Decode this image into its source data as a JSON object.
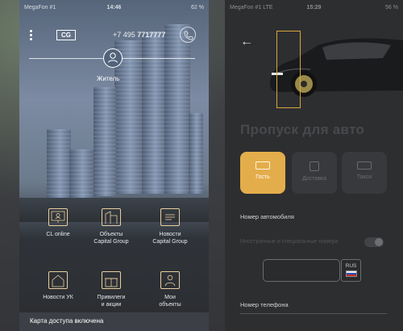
{
  "left_screen": {
    "statusbar": {
      "carrier": "MegaFon #1",
      "time": "14:46",
      "battery": "62 %"
    },
    "header": {
      "logo": "CG",
      "phone_prefix": "+7 495 ",
      "phone_main": "7717777"
    },
    "slider": {
      "label": "Житель"
    },
    "grid": [
      {
        "label": "CL online",
        "icon": "monitor-icon"
      },
      {
        "label": "Объекты\nCapital Group",
        "icon": "building-icon"
      },
      {
        "label": "Новости\nCapital Group",
        "icon": "news-icon"
      },
      {
        "label": "Новости УК",
        "icon": "house-icon"
      },
      {
        "label": "Привилеги\nи акции",
        "icon": "gift-icon"
      },
      {
        "label": "Мои\nобъекты",
        "icon": "user-home-icon"
      }
    ],
    "bottom_bar": {
      "text": "Карта доступа включена"
    }
  },
  "right_screen": {
    "statusbar": {
      "carrier": "MegaFon #1 LTE",
      "time": "15:29",
      "battery": "56 %"
    },
    "title": "Пропуск для авто",
    "types": [
      {
        "label": "Гость",
        "active": true,
        "icon": "car-icon"
      },
      {
        "label": "Доставка",
        "active": false,
        "icon": "delivery-icon"
      },
      {
        "label": "Такси",
        "active": false,
        "icon": "taxi-icon"
      }
    ],
    "plate": {
      "label": "Номер автомобиля",
      "foreign_label": "Иностранные и специальные номера",
      "region": "RUS"
    },
    "phone": {
      "label": "Номер телефона"
    }
  },
  "colors": {
    "accent": "#e4ad4b",
    "dark_bg": "#2d2e30"
  }
}
